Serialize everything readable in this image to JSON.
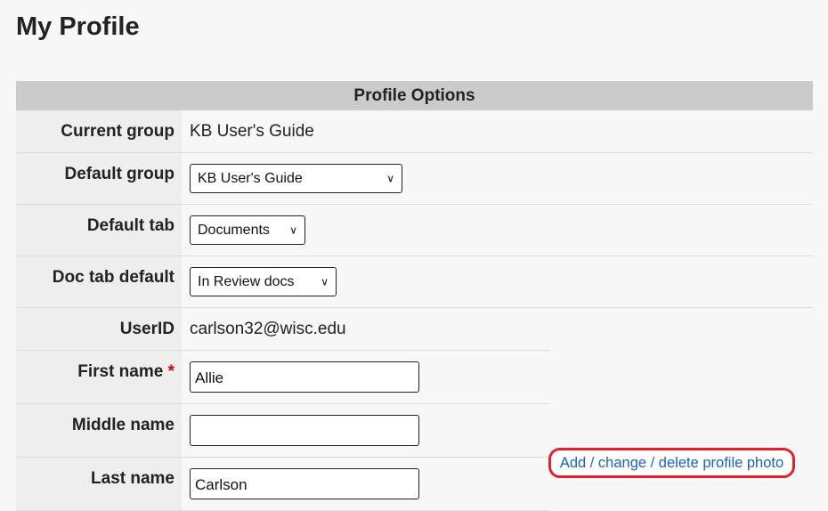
{
  "page": {
    "title": "My Profile"
  },
  "options_header": "Profile Options",
  "rows": {
    "current_group": {
      "label": "Current group",
      "value": "KB User's Guide"
    },
    "default_group": {
      "label": "Default group",
      "selected": "KB User's Guide"
    },
    "default_tab": {
      "label": "Default tab",
      "selected": "Documents"
    },
    "doc_tab_default": {
      "label": "Doc tab default",
      "selected": "In Review docs"
    },
    "userid": {
      "label": "UserID",
      "value": "carlson32@wisc.edu"
    },
    "first_name": {
      "label": "First name",
      "required_mark": "*",
      "value": "Allie",
      "placeholder": ""
    },
    "middle_name": {
      "label": "Middle name",
      "value": "",
      "placeholder": ""
    },
    "last_name": {
      "label": "Last name",
      "value": "Carlson",
      "placeholder": ""
    }
  },
  "photo_link": {
    "label": "Add / change / delete profile photo",
    "highlight_color": "#e0202a"
  },
  "icons": {
    "dropdown": "chevron-down-icon"
  }
}
